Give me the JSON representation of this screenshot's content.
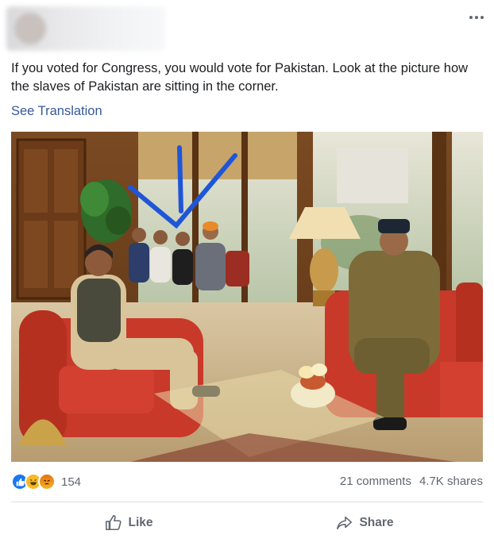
{
  "post": {
    "text": "If you voted for Congress, you would vote for Pakistan. Look at the picture how the slaves of Pakistan are sitting in the corner.",
    "see_translation": "See Translation"
  },
  "footer": {
    "reaction_count": "154",
    "comments": "21 comments",
    "shares": "4.7K shares",
    "like_label": "Like",
    "share_label": "Share"
  },
  "icons": {
    "menu": "more-options-icon",
    "reactions": [
      "like-reaction-icon",
      "haha-reaction-icon",
      "angry-reaction-icon"
    ],
    "like": "thumbs-up-icon",
    "share": "share-arrow-icon"
  },
  "colors": {
    "link": "#385898",
    "like_blue": "#1877f2",
    "secondary_text": "#606770",
    "annotation_arrow": "#1f56d8"
  }
}
